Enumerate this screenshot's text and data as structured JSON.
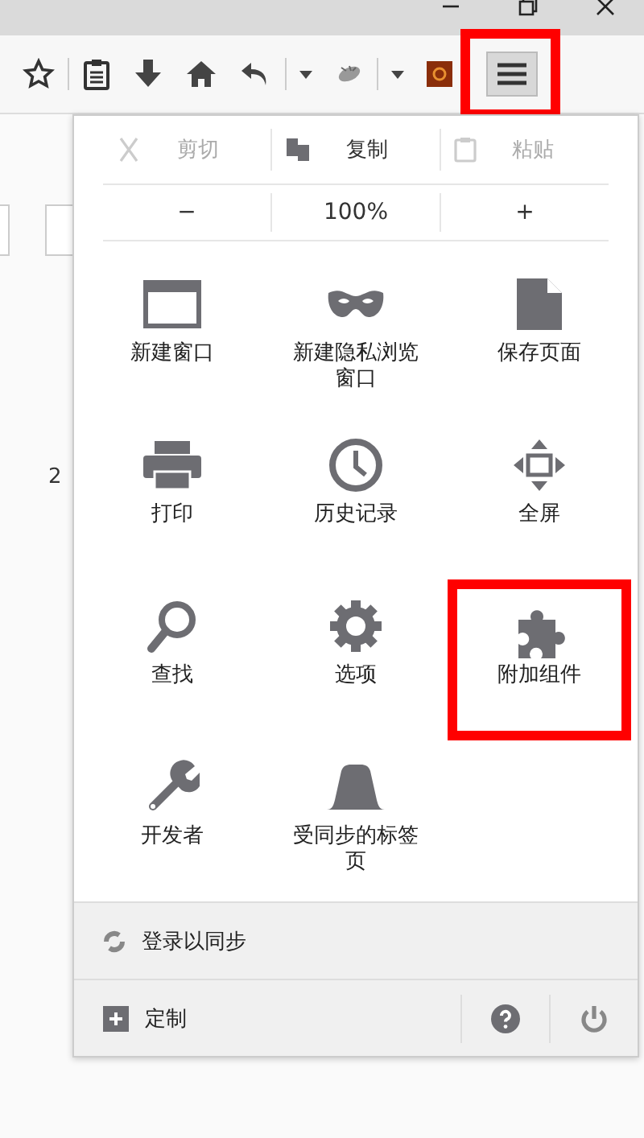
{
  "page_fragments": [
    {
      "text": "2"
    }
  ],
  "toolbar": {
    "menu_button": {
      "highlighted": true
    }
  },
  "menu": {
    "edit_row": [
      {
        "kind": "cut",
        "label": "剪切",
        "disabled": true
      },
      {
        "kind": "copy",
        "label": "复制",
        "disabled": false
      },
      {
        "kind": "paste",
        "label": "粘贴",
        "disabled": true
      }
    ],
    "zoom_row": {
      "out": "−",
      "level": "100%",
      "in": "+"
    },
    "items": [
      {
        "kind": "window",
        "label": "新建窗口",
        "highlighted": false
      },
      {
        "kind": "mask",
        "label": "新建隐私浏览窗口",
        "highlighted": false
      },
      {
        "kind": "page",
        "label": "保存页面",
        "highlighted": false
      },
      {
        "kind": "printer",
        "label": "打印",
        "highlighted": false
      },
      {
        "kind": "clock",
        "label": "历史记录",
        "highlighted": false
      },
      {
        "kind": "fullscreen",
        "label": "全屏",
        "highlighted": false
      },
      {
        "kind": "search",
        "label": "查找",
        "highlighted": false
      },
      {
        "kind": "gear",
        "label": "选项",
        "highlighted": false
      },
      {
        "kind": "puzzle",
        "label": "附加组件",
        "highlighted": true
      },
      {
        "kind": "wrench",
        "label": "开发者",
        "highlighted": false
      },
      {
        "kind": "tabs",
        "label": "受同步的标签页",
        "highlighted": false
      }
    ],
    "sync": "登录以同步",
    "customize": "定制"
  }
}
